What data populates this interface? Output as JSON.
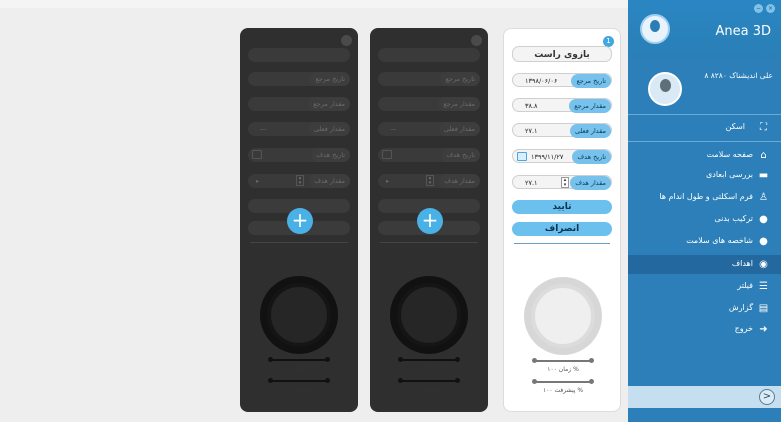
{
  "app": {
    "brand": "Anea 3D",
    "window_controls": [
      "minimize",
      "close"
    ]
  },
  "user": {
    "name": "علی اندیشناک ۸۲۸۰ ۸"
  },
  "nav": [
    {
      "label": "اسکن",
      "icon": "scan-icon"
    },
    {
      "label": "صفحه سلامت",
      "icon": "home-icon"
    },
    {
      "label": "بررسی ابعادی",
      "icon": "truck-icon"
    },
    {
      "label": "فرم اسکلتی و طول اندام ها",
      "icon": "skeleton-icon"
    },
    {
      "label": "ترکیب بدنی",
      "icon": "body-composition-icon"
    },
    {
      "label": "شاخصه های سلامت",
      "icon": "apple-icon"
    },
    {
      "label": "اهداف",
      "icon": "target-icon",
      "active": true
    },
    {
      "label": "فیلتر",
      "icon": "filter-icon"
    },
    {
      "label": "گزارش",
      "icon": "report-icon"
    },
    {
      "label": "خروج",
      "icon": "exit-icon"
    }
  ],
  "active_card": {
    "badge": "1",
    "title": "بازوی راست",
    "ref_date_label": "تاریخ مرجع",
    "ref_date_value": "۱۳۹۸/۰۶/۰۶",
    "ref_amount_label": "مقدار مرجع",
    "ref_amount_value": "۳۸.۸",
    "current_amount_label": "مقدار فعلی",
    "current_amount_value": "۲۷.۱",
    "target_date_label": "تاریخ هدف",
    "target_date_value": "۱۳۹۹/۱۱/۲۷",
    "target_amount_label": "مقدار هدف",
    "target_amount_value": "۲۷.۱",
    "confirm_label": "تایید",
    "cancel_label": "انصراف",
    "time_label": "زمان ۱۰۰ %",
    "progress_label": "پیشرفت ۱۰۰ %"
  },
  "placeholder_card": {
    "ref_date_label": "تاریخ مرجع",
    "ref_amount_label": "مقدار مرجع",
    "current_amount_label": "مقدار فعلی",
    "current_amount_value": "—",
    "target_date_label": "تاریخ هدف",
    "target_amount_label": "مقدار هدف",
    "add_label": "+",
    "time_label": "زمان ۱۰۰ %",
    "progress_label": "پیشرفت ۱۰۰ %"
  },
  "bottom": {
    "arrow": ">"
  }
}
